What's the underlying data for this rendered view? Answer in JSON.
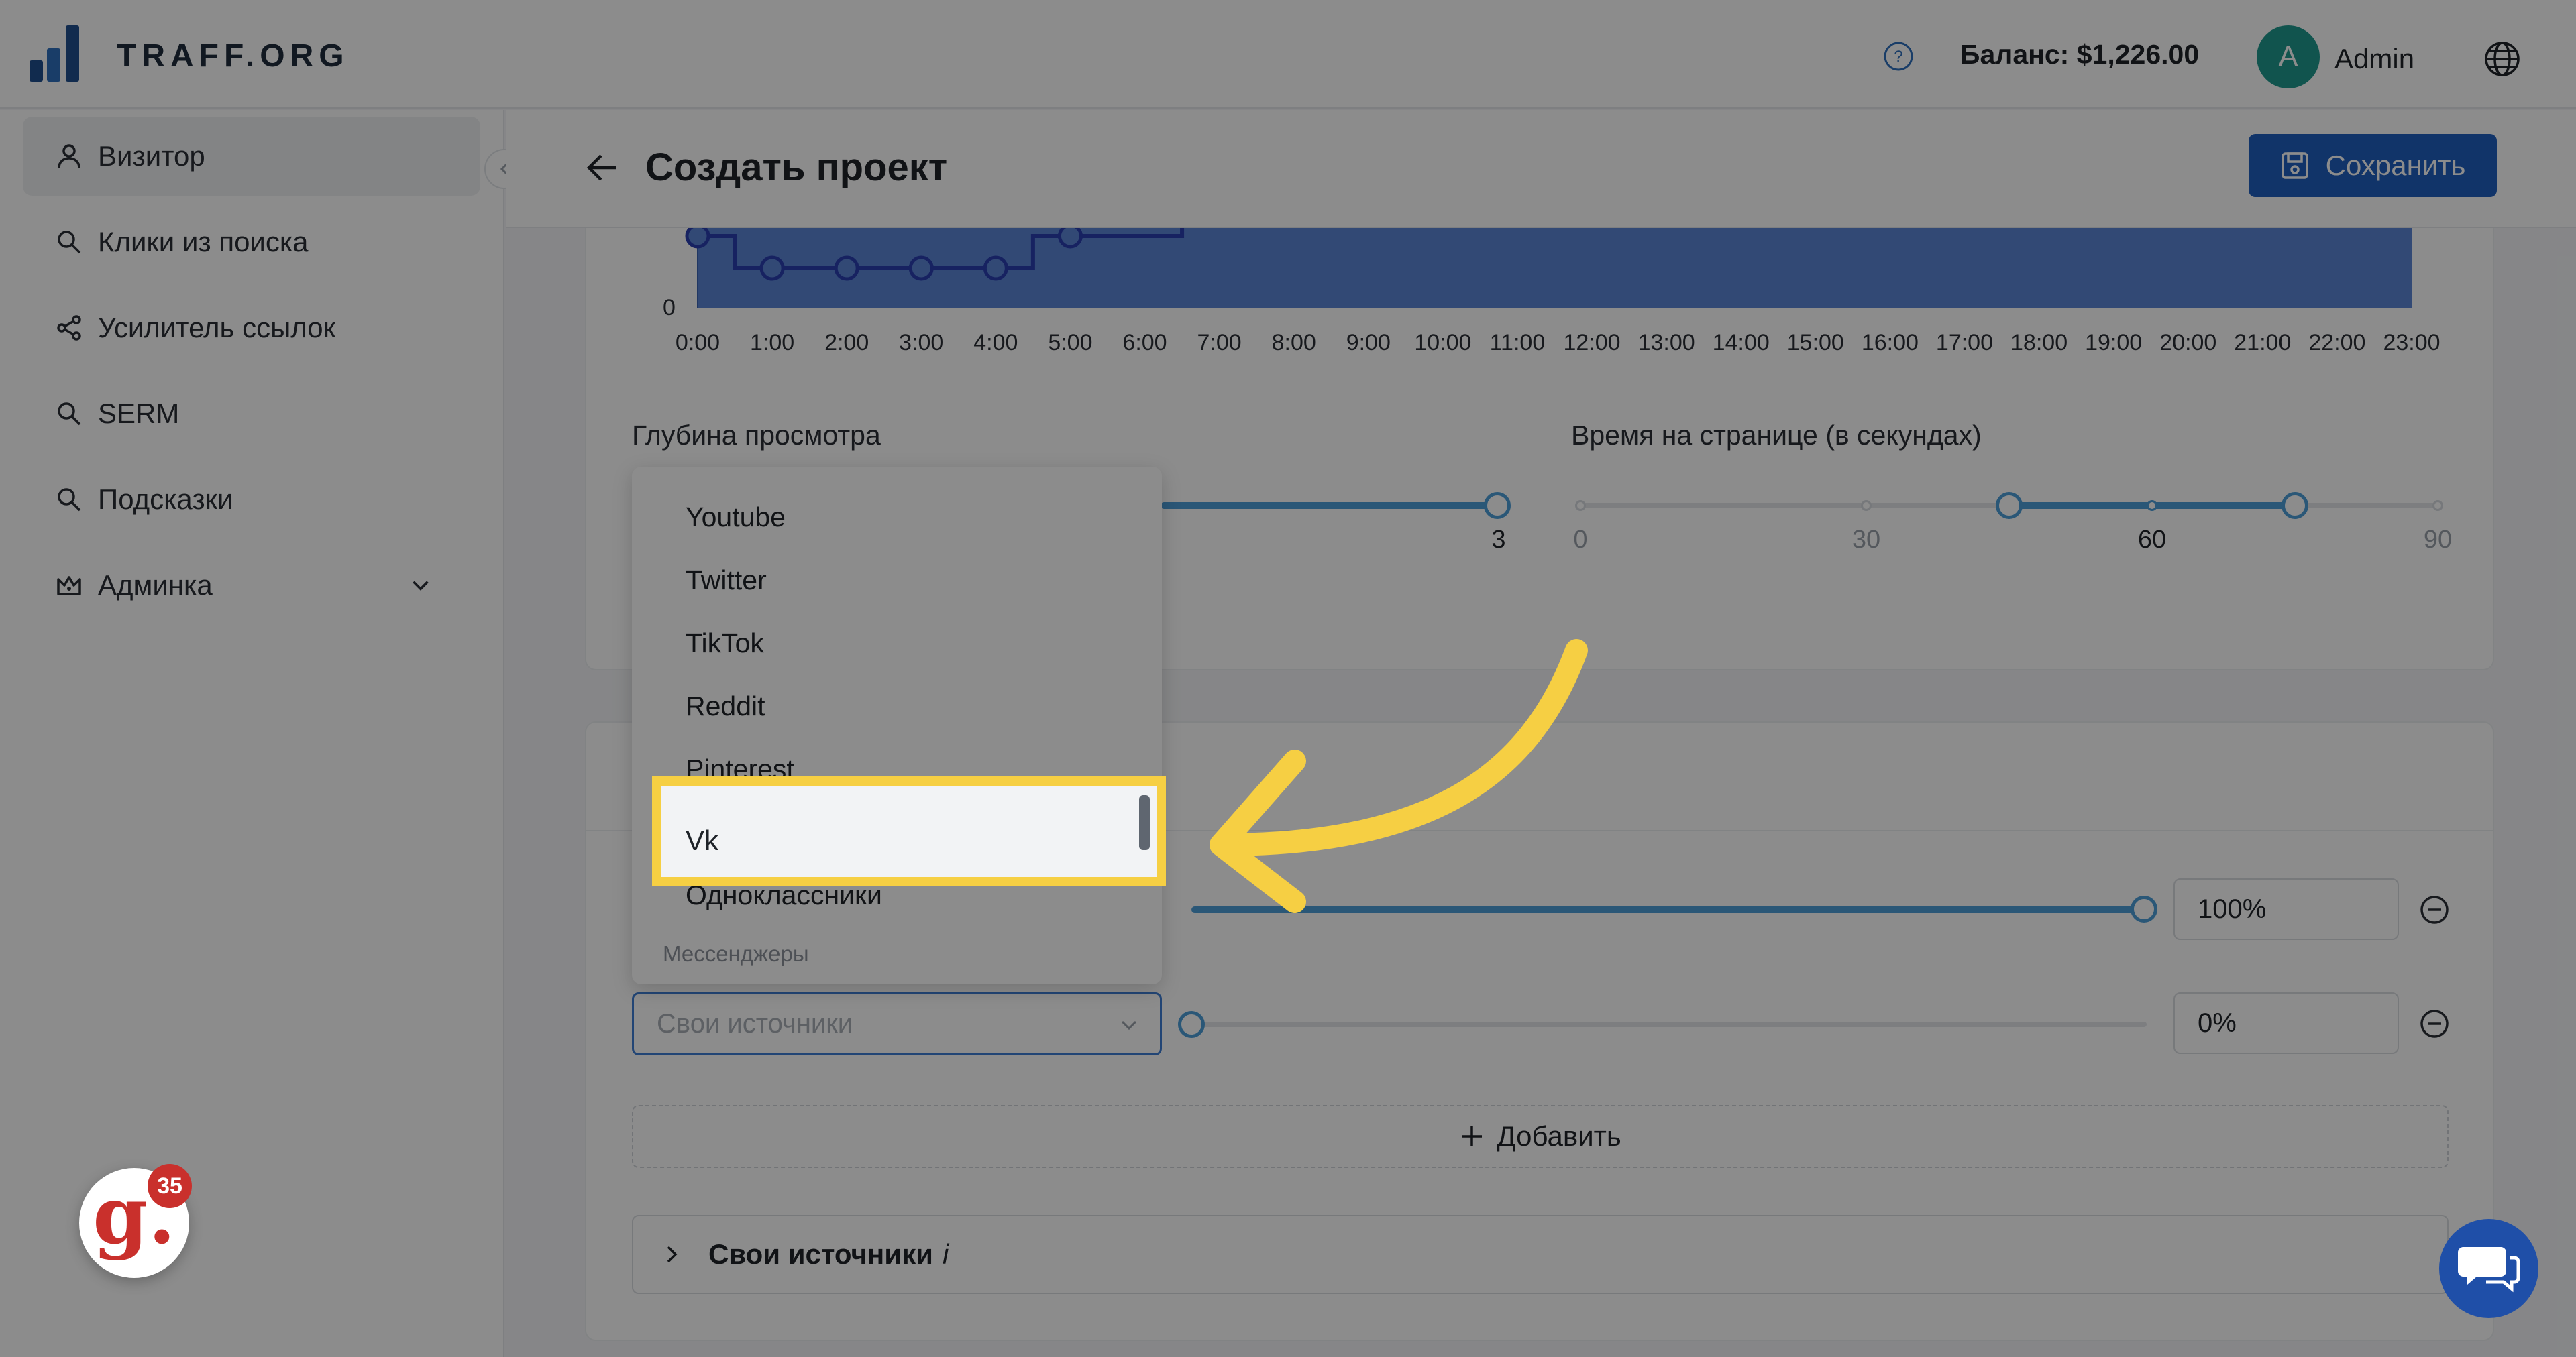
{
  "brand": {
    "name": "TRAFF.ORG"
  },
  "header": {
    "balance": "Баланс: $1,226.00",
    "avatar_letter": "A",
    "user_name": "Admin"
  },
  "sidebar": {
    "items": [
      {
        "label": "Визитор",
        "icon": "user-icon",
        "active": true
      },
      {
        "label": "Клики из поиска",
        "icon": "search-icon"
      },
      {
        "label": "Усилитель ссылок",
        "icon": "share-icon"
      },
      {
        "label": "SERM",
        "icon": "search-icon"
      },
      {
        "label": "Подсказки",
        "icon": "search-icon"
      },
      {
        "label": "Админка",
        "icon": "crown-icon",
        "expandable": true
      }
    ]
  },
  "page": {
    "title": "Создать проект",
    "save_label": "Сохранить"
  },
  "chart_data": {
    "type": "line",
    "x": [
      "0:00",
      "1:00",
      "2:00",
      "3:00",
      "4:00",
      "5:00",
      "6:00",
      "7:00",
      "8:00",
      "9:00",
      "10:00",
      "11:00",
      "12:00",
      "13:00",
      "14:00",
      "15:00",
      "16:00",
      "17:00",
      "18:00",
      "19:00",
      "20:00",
      "21:00",
      "22:00",
      "23:00"
    ],
    "y_visible_tick": "0",
    "step_values": [
      100,
      40,
      40,
      40,
      40,
      100,
      100
    ],
    "colors": {
      "line": "#2a3eb1",
      "area": "#5b86d6"
    }
  },
  "depth": {
    "label": "Глубина просмотра",
    "max_mark": "3"
  },
  "time_on_page": {
    "label": "Время на странице (в секундах)",
    "marks": [
      "0",
      "30",
      "60",
      "90"
    ],
    "range": [
      45,
      75
    ],
    "max": 90
  },
  "sources": {
    "rows": [
      {
        "percent": "100%"
      },
      {
        "percent": "0%"
      }
    ],
    "select_placeholder": "Свои источники",
    "add_label": "Добавить",
    "custom_sources_title": "Свои источники",
    "custom_sources_info": "i"
  },
  "dropdown": {
    "items": [
      "Youtube",
      "Twitter",
      "TikTok",
      "Reddit",
      "Pinterest",
      "Vk",
      "Одноклассники"
    ],
    "group_label": "Мессенджеры",
    "highlighted": "Vk"
  },
  "widgets": {
    "g_letter": "g.",
    "g_count": "35"
  },
  "colors": {
    "accent": "#1f5fbf",
    "highlight": "#f6cf43",
    "slider": "#4e9ed9"
  }
}
